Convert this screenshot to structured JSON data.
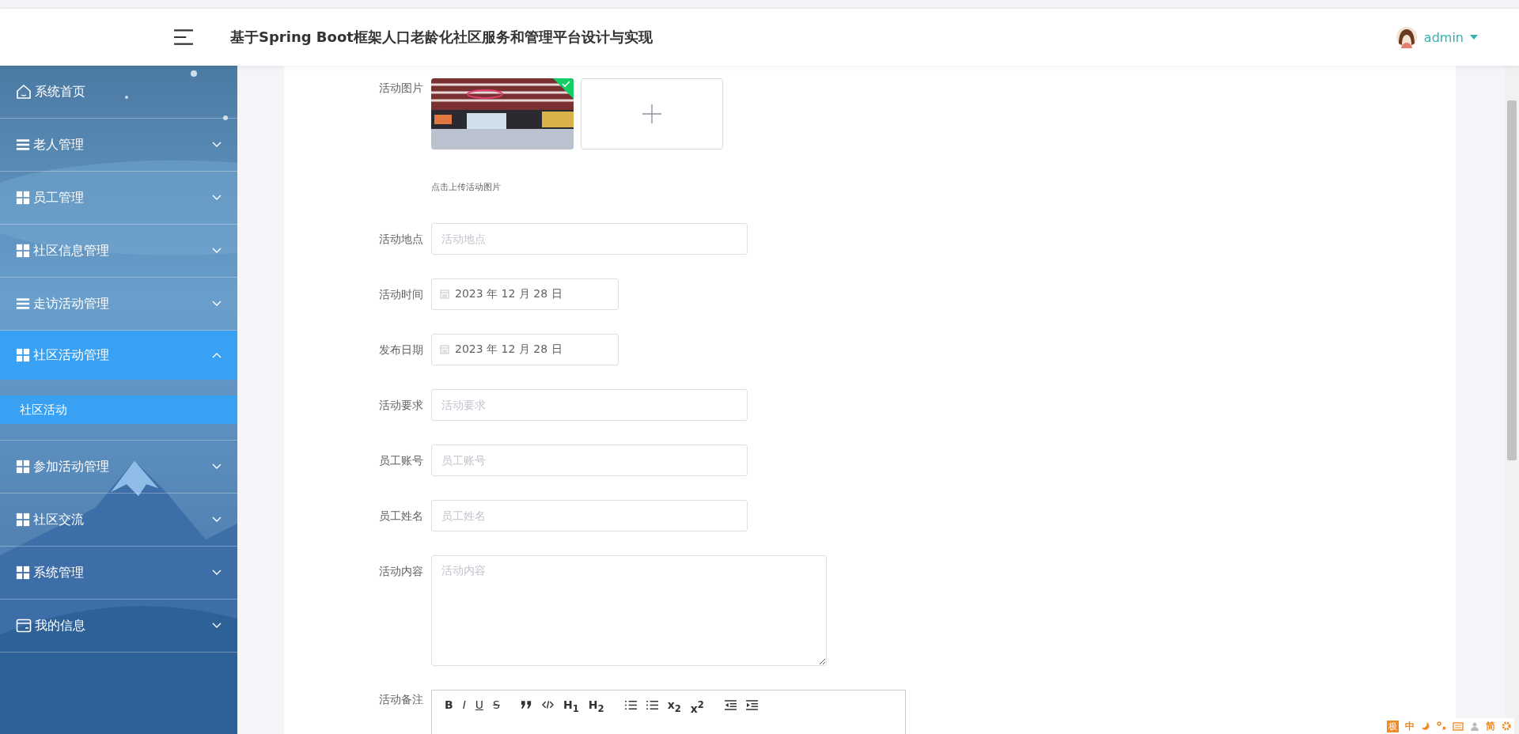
{
  "header": {
    "title": "基于Spring Boot框架人口老龄化社区服务和管理平台设计与实现",
    "user": "admin"
  },
  "menu": [
    {
      "kind": "home",
      "label": "系统首页"
    },
    {
      "kind": "list",
      "label": "老人管理",
      "expanded": false
    },
    {
      "kind": "grid",
      "label": "员工管理",
      "expanded": false
    },
    {
      "kind": "grid",
      "label": "社区信息管理",
      "expanded": false
    },
    {
      "kind": "list",
      "label": "走访活动管理",
      "expanded": false
    },
    {
      "kind": "grid",
      "label": "社区活动管理",
      "expanded": true,
      "children": [
        {
          "label": "社区活动",
          "selected": true
        }
      ]
    },
    {
      "kind": "grid",
      "label": "参加活动管理",
      "expanded": false
    },
    {
      "kind": "grid",
      "label": "社区交流",
      "expanded": false
    },
    {
      "kind": "grid",
      "label": "系统管理",
      "expanded": false
    },
    {
      "kind": "card",
      "label": "我的信息",
      "expanded": false
    }
  ],
  "form": [
    {
      "label": "活动图片",
      "hint": "点击上传活动图片",
      "uploaded": true
    },
    {
      "kind": "text",
      "label": "活动地点",
      "placeholder": "活动地点"
    },
    {
      "kind": "date",
      "label": "活动时间",
      "value": "2023 年 12 月 28 日"
    },
    {
      "kind": "date",
      "label": "发布日期",
      "value": "2023 年 12 月 28 日"
    },
    {
      "kind": "text",
      "label": "活动要求",
      "placeholder": "活动要求"
    },
    {
      "kind": "text",
      "label": "员工账号",
      "placeholder": "员工账号"
    },
    {
      "kind": "text",
      "label": "员工姓名",
      "placeholder": "员工姓名"
    },
    {
      "kind": "textarea",
      "label": "活动内容",
      "placeholder": "活动内容"
    },
    {
      "kind": "editor",
      "label": "活动备注",
      "tools": [
        {
          "kind": "bold",
          "label": "B"
        },
        {
          "kind": "italic",
          "label": "I"
        },
        {
          "kind": "underline",
          "label": "U"
        },
        {
          "kind": "strike",
          "label": "S"
        },
        {
          "kind": "quote"
        },
        {
          "kind": "code"
        },
        {
          "kind": "heading",
          "label": "H$_{1}$"
        },
        {
          "kind": "heading",
          "label": "H$_{2}$"
        },
        {
          "kind": "ol"
        },
        {
          "kind": "ul"
        },
        {
          "kind": "script",
          "label": "x$_{2}$"
        },
        {
          "kind": "script",
          "label": "x$^{2}$"
        },
        {
          "kind": "outdent"
        },
        {
          "kind": "indent"
        }
      ]
    }
  ],
  "ime": {
    "items": [
      {
        "kind": "logo",
        "label": "极"
      },
      {
        "kind": "text",
        "label": "中"
      },
      {
        "kind": "moon"
      },
      {
        "kind": "punct"
      },
      {
        "kind": "keyboard"
      },
      {
        "kind": "user"
      },
      {
        "kind": "text",
        "label": "简"
      },
      {
        "kind": "gear"
      }
    ]
  }
}
